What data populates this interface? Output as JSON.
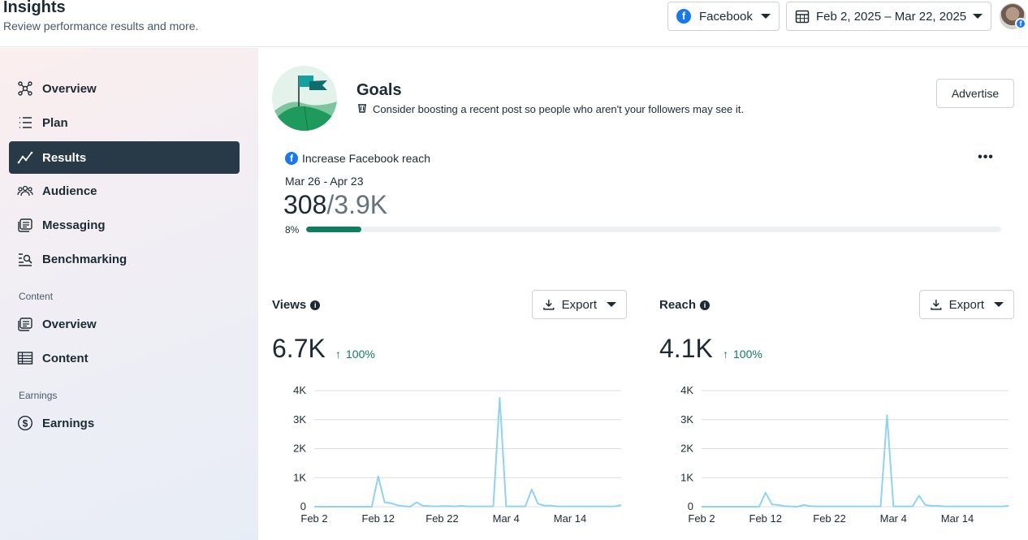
{
  "header": {
    "title": "Insights",
    "subtitle": "Review performance results and more.",
    "platform": "Facebook",
    "date_range": "Feb 2, 2025 – Mar 22, 2025"
  },
  "sidebar": {
    "items": [
      {
        "label": "Overview",
        "icon": "overview-icon"
      },
      {
        "label": "Plan",
        "icon": "plan-icon"
      },
      {
        "label": "Results",
        "icon": "results-icon",
        "active": true
      },
      {
        "label": "Audience",
        "icon": "audience-icon"
      },
      {
        "label": "Messaging",
        "icon": "messaging-icon"
      },
      {
        "label": "Benchmarking",
        "icon": "benchmarking-icon"
      }
    ],
    "content_section": "Content",
    "content_items": [
      {
        "label": "Overview",
        "icon": "content-overview-icon"
      },
      {
        "label": "Content",
        "icon": "content-table-icon"
      }
    ],
    "earnings_section": "Earnings",
    "earnings_items": [
      {
        "label": "Earnings",
        "icon": "dollar-icon"
      }
    ]
  },
  "goals": {
    "title": "Goals",
    "subtitle": "Consider boosting a recent post so people who aren't your followers may see it.",
    "advertise_label": "Advertise",
    "goal_name": "Increase Facebook reach",
    "range": "Mar 26 - Apr 23",
    "current": "308",
    "target": "/3.9K",
    "percent_label": "8%",
    "progress": 0.08
  },
  "views": {
    "title": "Views",
    "export_label": "Export",
    "value": "6.7K",
    "change": "100%"
  },
  "reach": {
    "title": "Reach",
    "export_label": "Export",
    "value": "4.1K",
    "change": "100%"
  },
  "colors": {
    "accent": "#0d7e5f",
    "line": "#8fd3f2",
    "sidebar_active": "#283a47",
    "facebook": "#1877f2"
  },
  "chart_data": [
    {
      "type": "line",
      "title": "Views",
      "x_ticks": [
        "Feb 2",
        "Feb 12",
        "Feb 22",
        "Mar 4",
        "Mar 14"
      ],
      "y_ticks": [
        "0",
        "1K",
        "2K",
        "3K",
        "4K"
      ],
      "ylim": [
        0,
        4000
      ],
      "x": [
        "Feb 2",
        "Feb 3",
        "Feb 4",
        "Feb 5",
        "Feb 6",
        "Feb 7",
        "Feb 8",
        "Feb 9",
        "Feb 10",
        "Feb 11",
        "Feb 12",
        "Feb 13",
        "Feb 14",
        "Feb 15",
        "Feb 16",
        "Feb 17",
        "Feb 18",
        "Feb 19",
        "Feb 20",
        "Feb 21",
        "Feb 22",
        "Feb 23",
        "Feb 24",
        "Feb 25",
        "Feb 26",
        "Feb 27",
        "Feb 28",
        "Mar 1",
        "Mar 2",
        "Mar 3",
        "Mar 4",
        "Mar 5",
        "Mar 6",
        "Mar 7",
        "Mar 8",
        "Mar 9",
        "Mar 10",
        "Mar 11",
        "Mar 12",
        "Mar 13",
        "Mar 14",
        "Mar 15",
        "Mar 16",
        "Mar 17",
        "Mar 18",
        "Mar 19",
        "Mar 20",
        "Mar 21",
        "Mar 22"
      ],
      "values": [
        0,
        0,
        0,
        0,
        0,
        0,
        0,
        0,
        0,
        0,
        1050,
        150,
        120,
        50,
        20,
        0,
        150,
        30,
        20,
        10,
        20,
        20,
        10,
        30,
        10,
        10,
        10,
        10,
        10,
        3750,
        10,
        10,
        10,
        10,
        600,
        100,
        40,
        40,
        10,
        10,
        10,
        10,
        10,
        10,
        10,
        10,
        10,
        10,
        60
      ],
      "grid": true
    },
    {
      "type": "line",
      "title": "Reach",
      "x_ticks": [
        "Feb 2",
        "Feb 12",
        "Feb 22",
        "Mar 4",
        "Mar 14"
      ],
      "y_ticks": [
        "0",
        "1K",
        "2K",
        "3K",
        "4K"
      ],
      "ylim": [
        0,
        4000
      ],
      "x": [
        "Feb 2",
        "Feb 3",
        "Feb 4",
        "Feb 5",
        "Feb 6",
        "Feb 7",
        "Feb 8",
        "Feb 9",
        "Feb 10",
        "Feb 11",
        "Feb 12",
        "Feb 13",
        "Feb 14",
        "Feb 15",
        "Feb 16",
        "Feb 17",
        "Feb 18",
        "Feb 19",
        "Feb 20",
        "Feb 21",
        "Feb 22",
        "Feb 23",
        "Feb 24",
        "Feb 25",
        "Feb 26",
        "Feb 27",
        "Feb 28",
        "Mar 1",
        "Mar 2",
        "Mar 3",
        "Mar 4",
        "Mar 5",
        "Mar 6",
        "Mar 7",
        "Mar 8",
        "Mar 9",
        "Mar 10",
        "Mar 11",
        "Mar 12",
        "Mar 13",
        "Mar 14",
        "Mar 15",
        "Mar 16",
        "Mar 17",
        "Mar 18",
        "Mar 19",
        "Mar 20",
        "Mar 21",
        "Mar 22"
      ],
      "values": [
        0,
        0,
        0,
        0,
        0,
        0,
        0,
        0,
        0,
        0,
        480,
        80,
        60,
        20,
        10,
        0,
        60,
        20,
        10,
        10,
        10,
        10,
        10,
        10,
        10,
        10,
        10,
        10,
        10,
        3150,
        10,
        10,
        10,
        10,
        380,
        60,
        30,
        30,
        10,
        10,
        10,
        10,
        10,
        10,
        10,
        10,
        10,
        10,
        30
      ],
      "grid": true
    }
  ]
}
